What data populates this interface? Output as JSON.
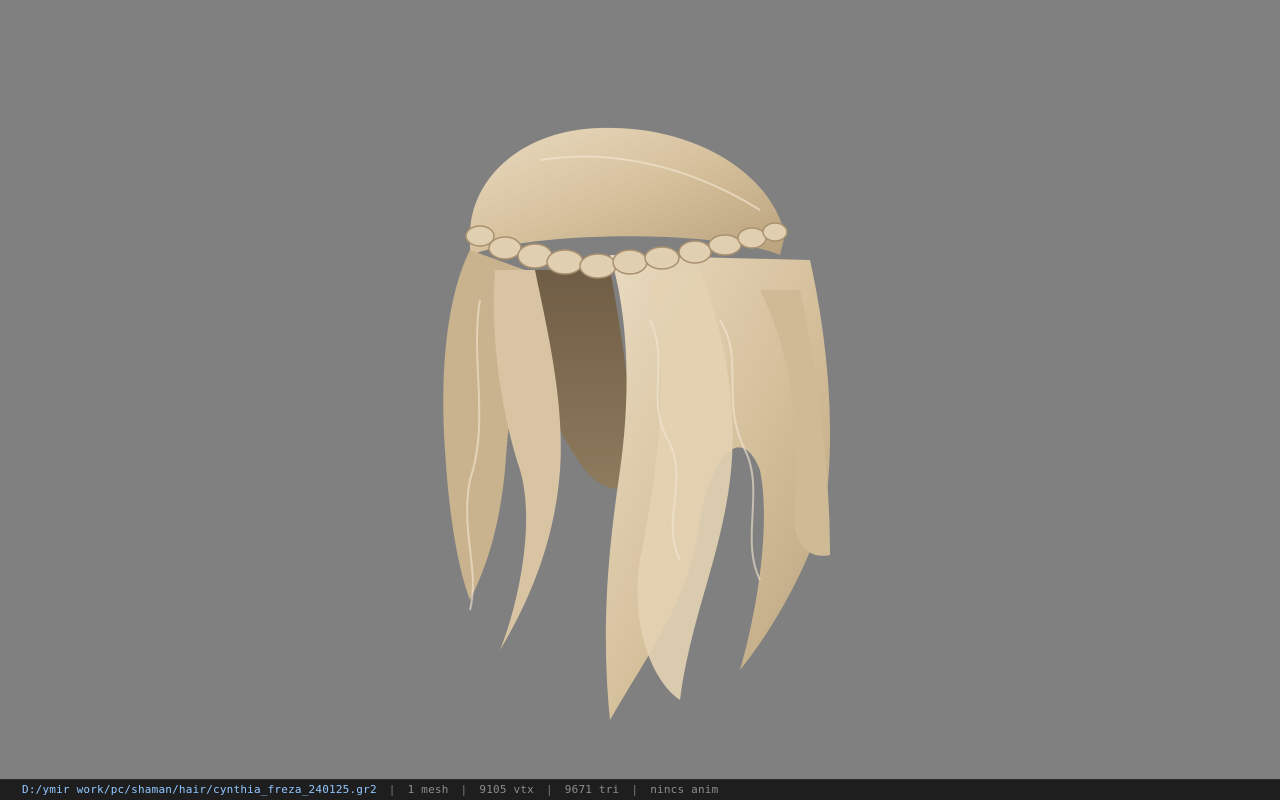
{
  "viewport": {
    "background_color": "#808080",
    "model_description_icon": "hair-model",
    "hair_color": "#d9c4a1"
  },
  "statusbar": {
    "file_path": "D:/ymir work/pc/shaman/hair/cynthia_freza_240125.gr2",
    "separator": "|",
    "mesh_count": "1 mesh",
    "vertex_count": "9105 vtx",
    "triangle_count": "9671 tri",
    "anim_status": "nincs anim"
  }
}
